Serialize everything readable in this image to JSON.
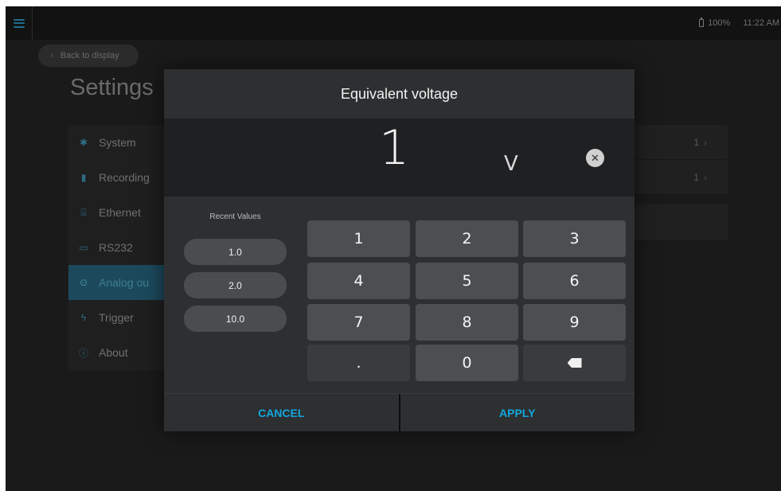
{
  "status": {
    "battery": "100%",
    "time": "11:22 AM"
  },
  "background": {
    "back_label": "Back to display",
    "page_title": "Settings",
    "nav_items": [
      {
        "label": "System",
        "icon": "gear-icon"
      },
      {
        "label": "Recording",
        "icon": "file-icon"
      },
      {
        "label": "Ethernet",
        "icon": "antenna-icon"
      },
      {
        "label": "RS232",
        "icon": "serial-port-icon"
      },
      {
        "label": "Analog ou",
        "icon": "target-icon",
        "active": true
      },
      {
        "label": "Trigger",
        "icon": "lightning-icon"
      },
      {
        "label": "About",
        "icon": "info-icon"
      }
    ],
    "right_values": [
      "1",
      "1"
    ]
  },
  "modal": {
    "title": "Equivalent voltage",
    "value": "1",
    "unit": "V",
    "recent_label": "Recent Values",
    "recent_values": [
      "1.0",
      "2.0",
      "10.0"
    ],
    "keys": [
      "1",
      "2",
      "3",
      "4",
      "5",
      "6",
      "7",
      "8",
      "9",
      ".",
      "0"
    ],
    "cancel_label": "CANCEL",
    "apply_label": "APPLY"
  },
  "colors": {
    "accent": "#12a6dc",
    "active_nav": "#1c4a5c"
  }
}
